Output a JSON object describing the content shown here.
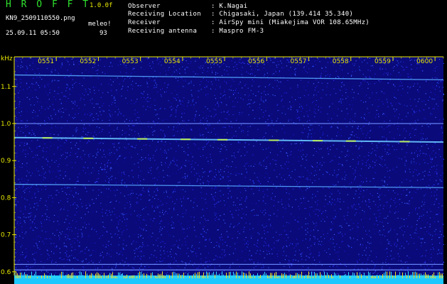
{
  "header": {
    "logo": "H R O F F T",
    "version": "1.0.0f",
    "filename": "KN9_2509110550.png",
    "datetime": "25.09.11 05:50",
    "meleo": "meleo!",
    "number": "93",
    "info": [
      {
        "label": "Observer",
        "value": ": K.Nagai"
      },
      {
        "label": "Receiving Location",
        "value": ": Chigasaki, Japan (139.414 35.340)"
      },
      {
        "label": "Receiver",
        "value": ": AirSpy mini (Miakejima VOR 108.65MHz)"
      },
      {
        "label": "Receiving antenna",
        "value": ": Maspro FM-3"
      }
    ]
  },
  "chart_data": {
    "type": "heatmap",
    "ylabel": "kHz",
    "y_ticks": [
      "1.1",
      "1.0",
      "0.9",
      "0.8",
      "0.7",
      "0.6"
    ],
    "y_tick_values": [
      1.1,
      1.0,
      0.9,
      0.8,
      0.7,
      0.6
    ],
    "ylim": [
      0.59,
      1.18
    ],
    "x_ticks": [
      "0551",
      "0552",
      "0553",
      "0554",
      "0555",
      "0556",
      "0557",
      "0558",
      "0559",
      "0600"
    ],
    "x_tick_values": [
      1,
      2,
      3,
      4,
      5,
      6,
      7,
      8,
      9,
      10
    ],
    "xlim": [
      0,
      10.2
    ],
    "signals": [
      {
        "freq_start": 1.131,
        "freq_end": 1.118,
        "intensity": "medium"
      },
      {
        "freq_start": 1.0,
        "freq_end": 1.0,
        "intensity": "low"
      },
      {
        "freq_start": 0.962,
        "freq_end": 0.95,
        "intensity": "high"
      },
      {
        "freq_start": 0.836,
        "freq_end": 0.827,
        "intensity": "medium"
      },
      {
        "freq_start": 0.62,
        "freq_end": 0.62,
        "intensity": "low"
      },
      {
        "freq_start": 0.605,
        "freq_end": 0.605,
        "intensity": "low"
      }
    ],
    "colors": {
      "background": "#0a0a7a",
      "noise": "#1a1ad0",
      "signal": "#55a8ff",
      "peak": "#b8f060",
      "axis": "#e8e800",
      "bottom_bar": "#1ec8ff"
    }
  }
}
